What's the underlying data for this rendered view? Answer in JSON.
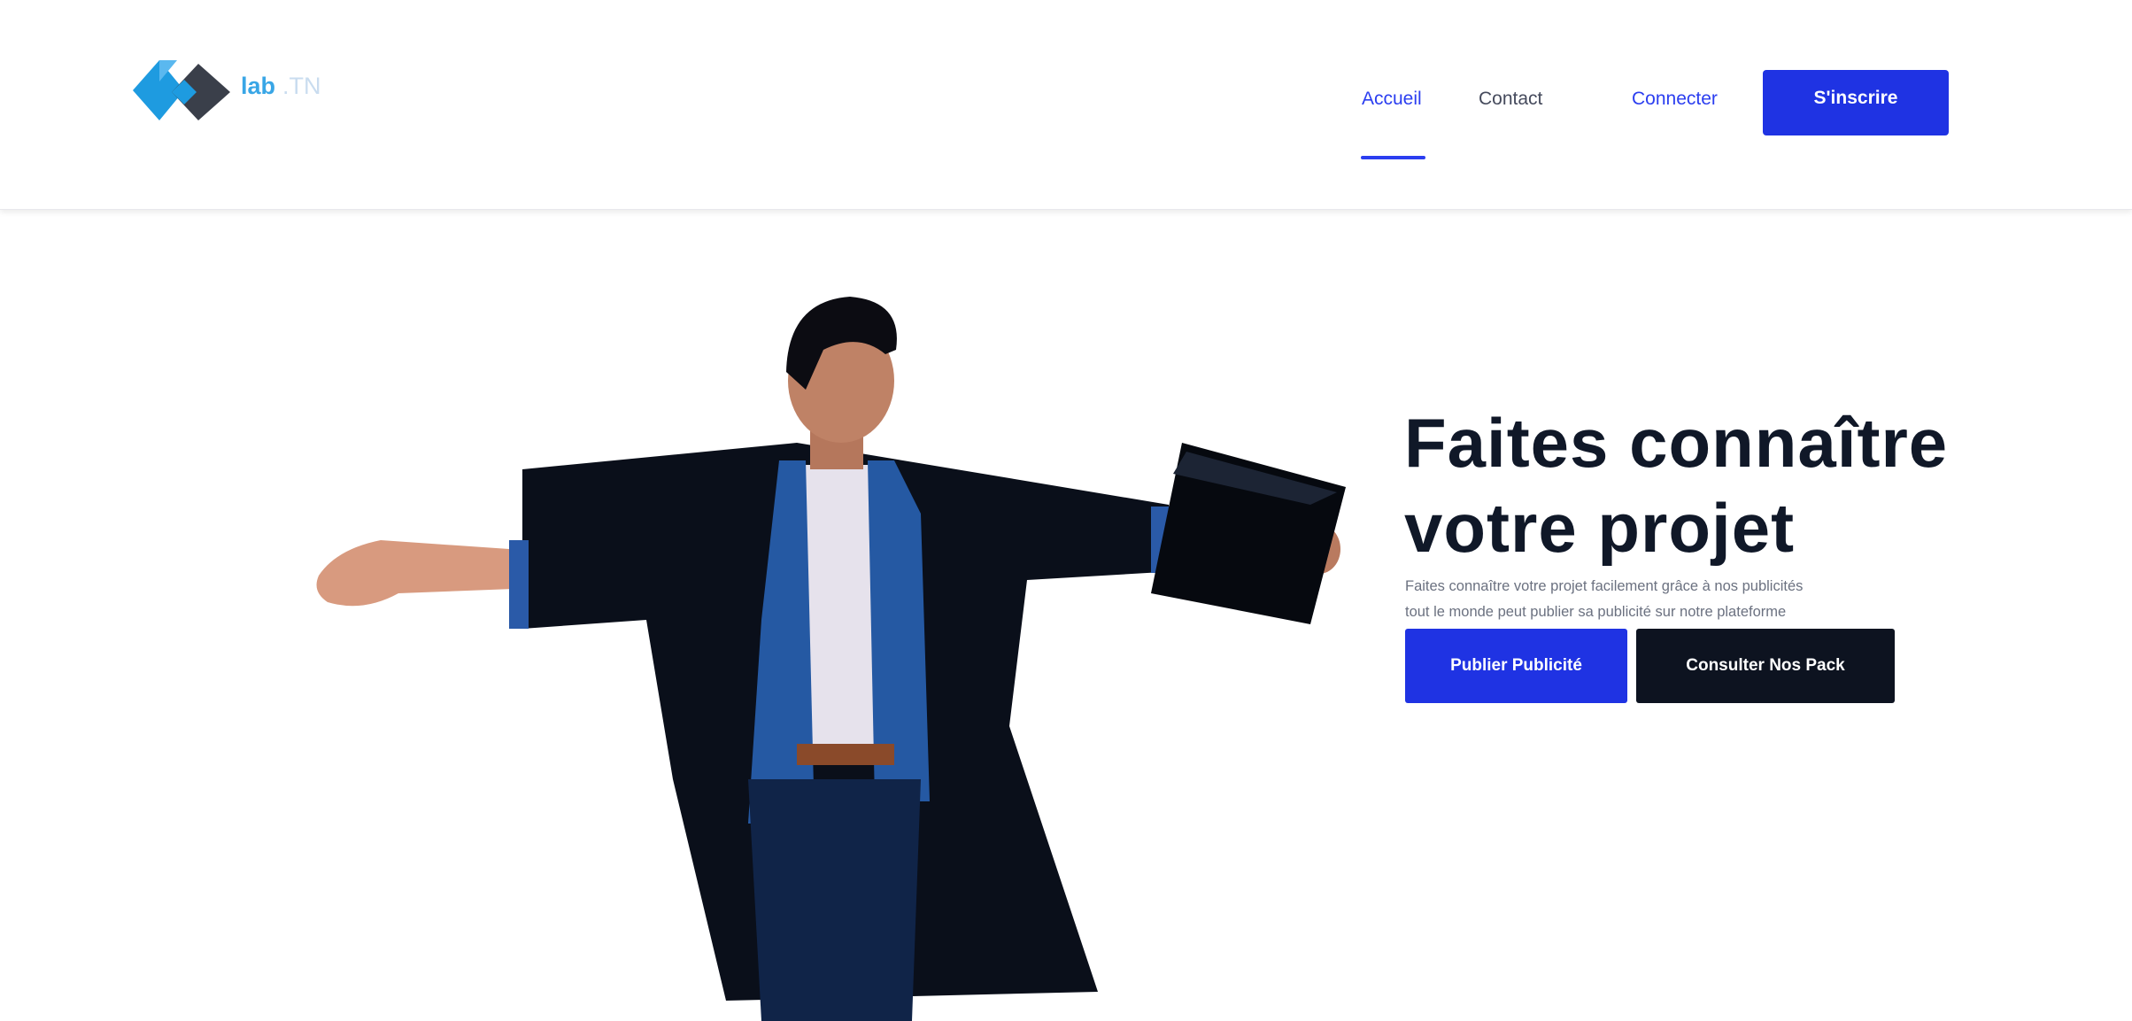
{
  "header": {
    "logo": {
      "text_main": "lab",
      "text_suffix": ".TN"
    },
    "nav": {
      "accueil": "Accueil",
      "contact": "Contact",
      "connecter": "Connecter"
    },
    "signup_label": "S'inscrire",
    "active_item": "Accueil"
  },
  "hero": {
    "title_line1": "Faites connaître",
    "title_line2": "votre projet",
    "description_line1": "Faites connaître votre projet facilement grâce à nos publicités",
    "description_line2": "tout le monde peut publier sa publicité sur notre plateforme",
    "primary_button": "Publier Publicité",
    "secondary_button": "Consulter Nos Pack",
    "illustration": "graduate-student-illustration"
  },
  "colors": {
    "primary": "#1f33e3",
    "dark": "#0d1320",
    "logo_blue": "#39a6e6",
    "logo_dark": "#3a3f4a",
    "title": "#101828"
  }
}
